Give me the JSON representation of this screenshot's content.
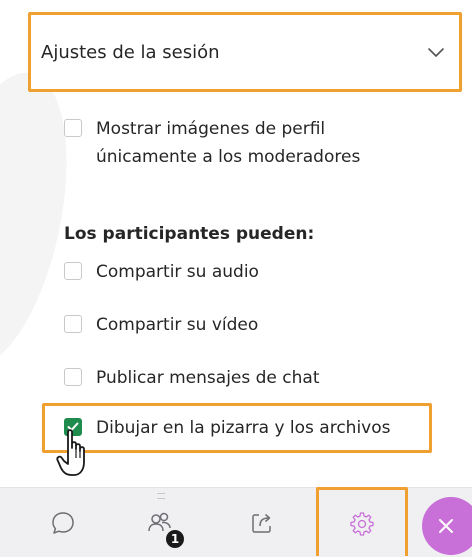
{
  "header": {
    "title": "Ajustes de la sesión"
  },
  "options": {
    "profile_images": {
      "line1": "Mostrar imágenes de perfil",
      "line2": "únicamente a los moderadores",
      "checked": false
    },
    "participants_label": "Los participantes pueden:",
    "share_audio": {
      "label": "Compartir su audio",
      "checked": false
    },
    "share_video": {
      "label": "Compartir su vídeo",
      "checked": false
    },
    "post_chat": {
      "label": "Publicar mensajes de chat",
      "checked": false
    },
    "draw_whiteboard": {
      "label": "Dibujar en la pizarra y los archivos",
      "checked": true
    }
  },
  "bottom_bar": {
    "tabs": [
      {
        "icon": "chat-icon"
      },
      {
        "icon": "participants-icon",
        "badge": "1"
      },
      {
        "icon": "share-content-icon"
      },
      {
        "icon": "settings-icon"
      }
    ],
    "close_icon": "close-icon"
  },
  "colors": {
    "highlight": "#f0a030",
    "checkbox_checked": "#1f8c4e",
    "close_button": "#c86fd8",
    "bottom_bar_bg": "#f0f0f2"
  }
}
